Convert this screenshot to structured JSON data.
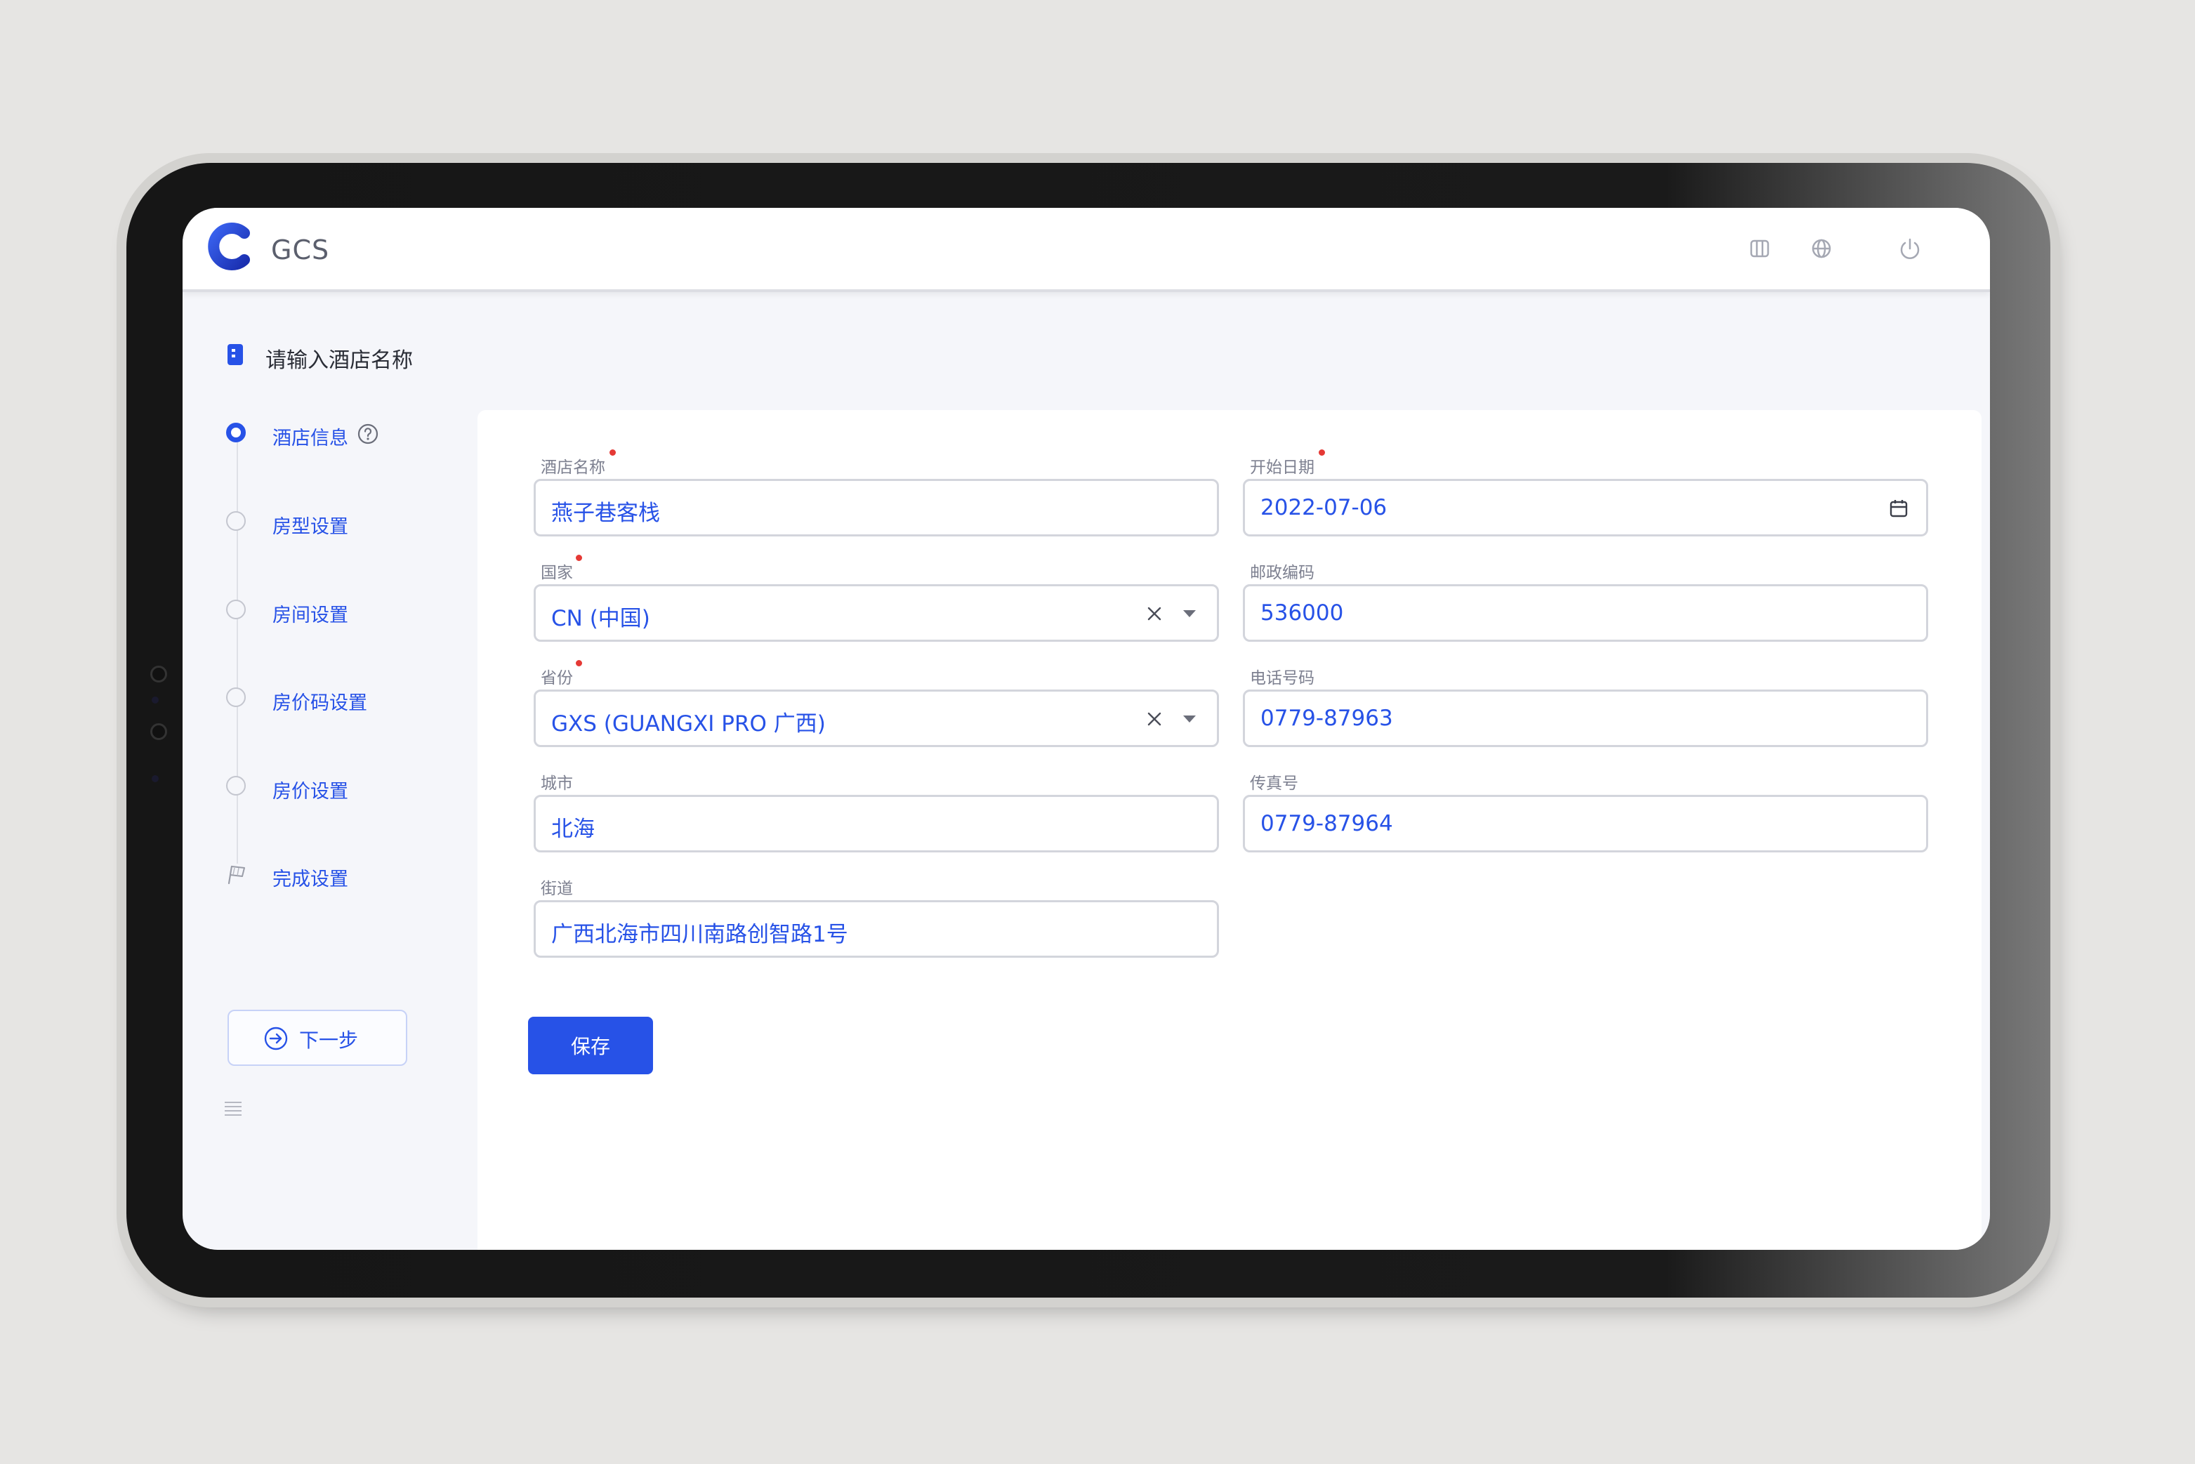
{
  "app": {
    "brand": "GCS"
  },
  "header": {
    "icons": [
      "layout-columns-icon",
      "globe-icon",
      "power-icon"
    ]
  },
  "breadcrumb": {
    "title": "请输入酒店名称"
  },
  "steps": [
    {
      "label": "酒店信息",
      "state": "active"
    },
    {
      "label": "房型设置",
      "state": "pending"
    },
    {
      "label": "房间设置",
      "state": "pending"
    },
    {
      "label": "房价码设置",
      "state": "pending"
    },
    {
      "label": "房价设置",
      "state": "pending"
    },
    {
      "label": "完成设置",
      "state": "finish"
    }
  ],
  "next_button": {
    "label": "下一步"
  },
  "form": {
    "hotel_name": {
      "label": "酒店名称",
      "value": "燕子巷客栈",
      "required": true
    },
    "start_date": {
      "label": "开始日期",
      "value": "2022-07-06",
      "required": true
    },
    "country": {
      "label": "国家",
      "value": "CN (中国)",
      "required": true
    },
    "postal_code": {
      "label": "邮政编码",
      "value": "536000",
      "required": false
    },
    "province": {
      "label": "省份",
      "value": "GXS (GUANGXI PRO 广西)",
      "required": true
    },
    "phone": {
      "label": "电话号码",
      "value": "0779-87963",
      "required": false
    },
    "city": {
      "label": "城市",
      "value": "北海",
      "required": false
    },
    "fax": {
      "label": "传真号",
      "value": "0779-87964",
      "required": false
    },
    "street": {
      "label": "街道",
      "value": "广西北海市四川南路创智路1号",
      "required": false
    },
    "save_label": "保存"
  },
  "colors": {
    "accent": "#2752e7",
    "required_dot": "#e53935",
    "page_bg": "#e6e5e3"
  }
}
